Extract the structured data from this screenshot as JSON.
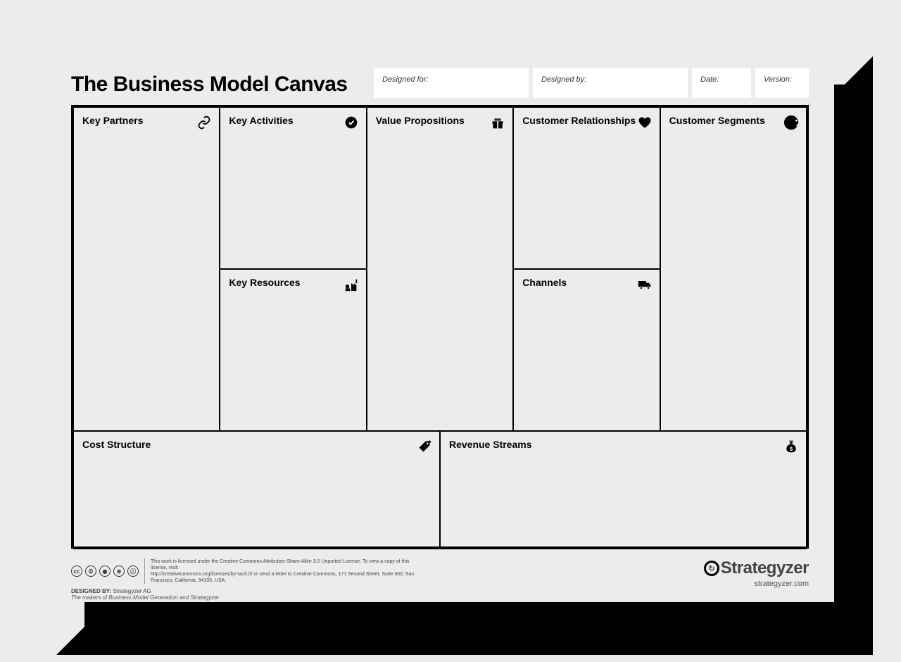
{
  "title": "The Business Model Canvas",
  "meta": {
    "designed_for": "Designed for:",
    "designed_by": "Designed by:",
    "date": "Date:",
    "version": "Version:"
  },
  "cells": {
    "key_partners": "Key Partners",
    "key_activities": "Key Activities",
    "key_resources": "Key Resources",
    "value_propositions": "Value Propositions",
    "customer_relationships": "Customer Relationships",
    "channels": "Channels",
    "customer_segments": "Customer Segments",
    "cost_structure": "Cost Structure",
    "revenue_streams": "Revenue Streams"
  },
  "footer": {
    "license_line1": "This work is licensed under the Creative Commons Attribution-Share Alike 3.0 Unported License. To view a copy of this license, visit:",
    "license_line2": "http://creativecommons.org/licenses/by-sa/3.0/ or send a letter to Creative Commons, 171 Second Street, Suite 300, San Francisco, California, 94105, USA.",
    "designed_by_label": "DESIGNED BY:",
    "designed_by_value": "Strategyzer AG",
    "makers": "The makers of Business Model Generation and Strategyzer",
    "logo_text": "Strategyzer",
    "logo_url": "strategyzer.com"
  }
}
